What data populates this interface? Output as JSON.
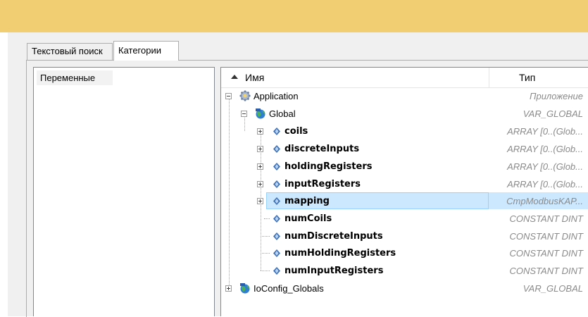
{
  "tabs": [
    {
      "label": "Текстовый поиск",
      "active": false
    },
    {
      "label": "Категории",
      "active": true
    }
  ],
  "left_list": {
    "items": [
      "Переменные"
    ]
  },
  "tree": {
    "columns": {
      "name": "Имя",
      "type": "Тип"
    },
    "rows": [
      {
        "name": "Application",
        "type": "Приложение",
        "icon": "application-gear-icon"
      },
      {
        "name": "Global",
        "type": "VAR_GLOBAL",
        "icon": "global-globe-icon"
      },
      {
        "name": "coils",
        "type": "ARRAY [0..(Glob...",
        "icon": "variable-icon"
      },
      {
        "name": "discreteInputs",
        "type": "ARRAY [0..(Glob...",
        "icon": "variable-icon"
      },
      {
        "name": "holdingRegisters",
        "type": "ARRAY [0..(Glob...",
        "icon": "variable-icon"
      },
      {
        "name": "inputRegisters",
        "type": "ARRAY [0..(Glob...",
        "icon": "variable-icon"
      },
      {
        "name": "mapping",
        "type": "CmpModbusKAP...",
        "icon": "variable-icon",
        "selected": true
      },
      {
        "name": "numCoils",
        "type": "CONSTANT DINT",
        "icon": "variable-icon"
      },
      {
        "name": "numDiscreteInputs",
        "type": "CONSTANT DINT",
        "icon": "variable-icon"
      },
      {
        "name": "numHoldingRegisters",
        "type": "CONSTANT DINT",
        "icon": "variable-icon"
      },
      {
        "name": "numInputRegisters",
        "type": "CONSTANT DINT",
        "icon": "variable-icon"
      },
      {
        "name": "IoConfig_Globals",
        "type": "VAR_GLOBAL",
        "icon": "global-globe-icon"
      }
    ]
  },
  "colors": {
    "titlebar": "#f2ce73",
    "selection": "#cce8ff"
  }
}
